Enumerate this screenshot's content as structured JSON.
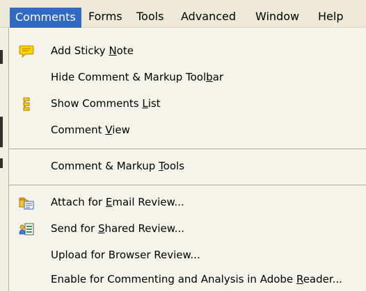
{
  "menubar": {
    "items": [
      "Comments",
      "Forms",
      "Tools",
      "Advanced",
      "Window",
      "Help"
    ],
    "active": "Comments"
  },
  "menu": {
    "items": [
      {
        "pre": "Add Sticky ",
        "key": "N",
        "post": "ote",
        "icon": "sticky-note-icon"
      },
      {
        "pre": "Hide Comment & Markup Tool",
        "key": "b",
        "post": "ar",
        "icon": ""
      },
      {
        "pre": "Show Comments ",
        "key": "L",
        "post": "ist",
        "icon": "comments-list-icon"
      },
      {
        "pre": "Comment ",
        "key": "V",
        "post": "iew",
        "icon": ""
      },
      {
        "pre": "Comment & Markup ",
        "key": "T",
        "post": "ools",
        "icon": ""
      },
      {
        "pre": "Attach for ",
        "key": "E",
        "post": "mail Review...",
        "icon": "email-review-icon"
      },
      {
        "pre": "Send for ",
        "key": "S",
        "post": "hared Review...",
        "icon": "shared-review-icon"
      },
      {
        "pre": "Upload for Browser Review...",
        "key": "",
        "post": "",
        "icon": ""
      },
      {
        "pre": "Enable for Commenting and Analysis in Adobe ",
        "key": "R",
        "post": "eader...",
        "icon": ""
      }
    ]
  }
}
